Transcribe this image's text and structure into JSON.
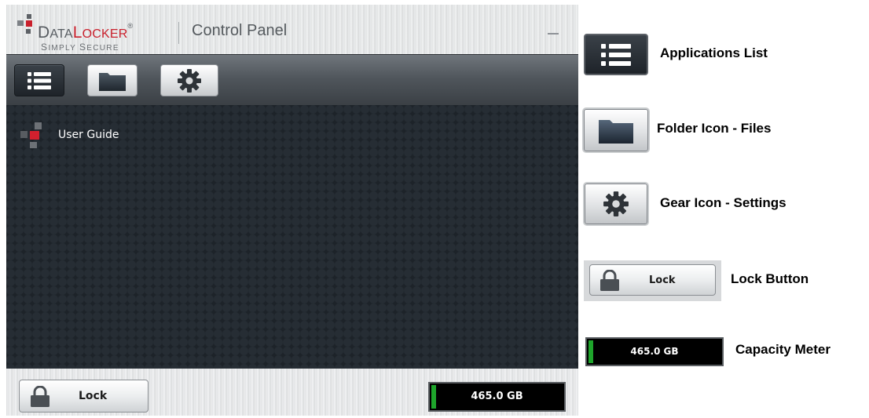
{
  "app": {
    "brand": {
      "name_prefix_big": "D",
      "name_prefix_small": "ATA",
      "name_suffix_big": "L",
      "name_suffix_small": "OCKER",
      "registered": "®",
      "tagline_big1": "S",
      "tagline_small1": "IMPLY ",
      "tagline_big2": "S",
      "tagline_small2": "ECURE"
    },
    "window_title": "Control Panel",
    "minimize_icon": "minimize-icon",
    "toolbar": {
      "buttons": [
        {
          "name": "applications-list",
          "icon": "list-icon",
          "style": "dark-active"
        },
        {
          "name": "files",
          "icon": "folder-icon",
          "style": "light"
        },
        {
          "name": "settings",
          "icon": "gear-icon",
          "style": "light"
        }
      ]
    },
    "applications": [
      {
        "label": "User Guide",
        "icon": "datalocker-logo-icon"
      }
    ],
    "status_bar": {
      "lock_label": "Lock",
      "capacity": "465.0 GB",
      "capacity_used_fraction": 0.04
    }
  },
  "legend": {
    "applications_list": "Applications List",
    "folder": "Folder Icon - Files",
    "gear": "Gear Icon - Settings",
    "lock_button": "Lock Button",
    "lock_button_label": "Lock",
    "capacity_meter": "Capacity Meter",
    "capacity_value": "465.0 GB"
  },
  "colors": {
    "brand_red": "#c9202c",
    "brand_gray": "#565b60",
    "content_bg": "#1d2329",
    "meter_fill": "#1ea52b",
    "meter_bg": "#000000"
  }
}
